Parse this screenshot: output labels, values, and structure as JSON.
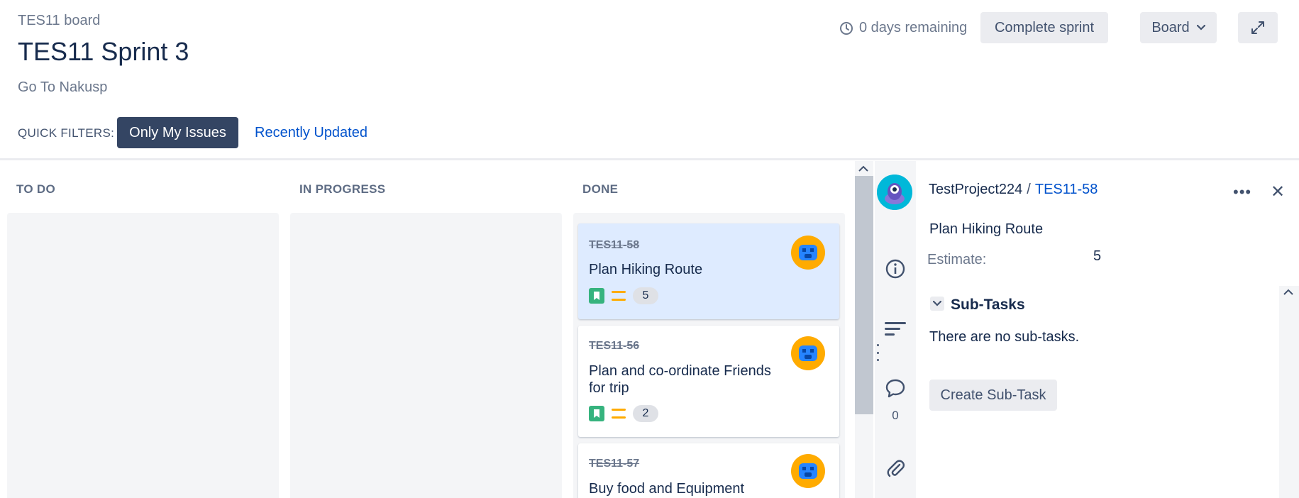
{
  "header": {
    "board_name": "TES11 board",
    "sprint_title": "TES11 Sprint 3",
    "sprint_goal": "Go To Nakusp",
    "remaining": "0 days remaining",
    "complete_sprint_label": "Complete sprint",
    "board_menu_label": "Board"
  },
  "quick_filters": {
    "label": "QUICK FILTERS:",
    "items": [
      {
        "label": "Only My Issues",
        "active": true
      },
      {
        "label": "Recently Updated",
        "active": false
      }
    ]
  },
  "columns": [
    {
      "name": "TO DO"
    },
    {
      "name": "IN PROGRESS"
    },
    {
      "name": "DONE"
    }
  ],
  "cards": [
    {
      "key": "TES11-58",
      "title": "Plan Hiking Route",
      "points": "5",
      "selected": true
    },
    {
      "key": "TES11-56",
      "title": "Plan and co-ordinate Friends for trip",
      "points": "2",
      "selected": false
    },
    {
      "key": "TES11-57",
      "title": "Buy food and Equipment",
      "points": "",
      "selected": false
    }
  ],
  "panel": {
    "project": "TestProject224",
    "separator": "/",
    "issue_key": "TES11-58",
    "summary": "Plan Hiking Route",
    "estimate_label": "Estimate:",
    "estimate_value": "5",
    "subtasks_heading": "Sub-Tasks",
    "subtasks_empty": "There are no sub-tasks.",
    "create_subtask_label": "Create Sub-Task",
    "comment_count": "0",
    "more_label": "•••",
    "close_label": "✕"
  },
  "icons": {
    "clock": "clock-icon",
    "chevron": "chevron-down-icon",
    "expand": "expand-icon",
    "info": "info-icon",
    "details": "details-icon",
    "comment": "comment-icon",
    "attach": "paperclip-icon"
  },
  "colors": {
    "accent": "#0052cc",
    "active_filter": "#344563",
    "selected_card": "#deebff",
    "story": "#36b37e",
    "priority_medium": "#ffab00"
  }
}
